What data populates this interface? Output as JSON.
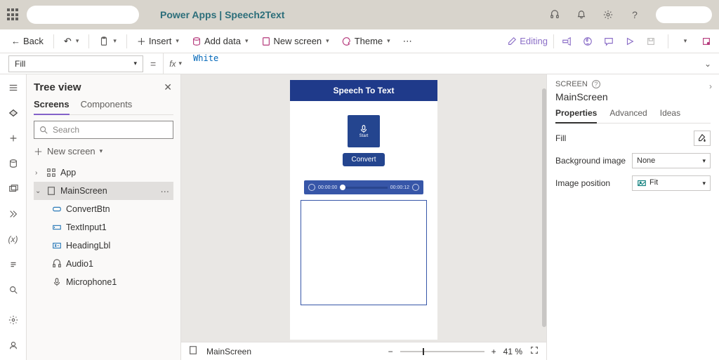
{
  "header": {
    "app": "Power Apps",
    "pipe": "|",
    "doc": "Speech2Text"
  },
  "commandbar": {
    "back": "Back",
    "insert": "Insert",
    "add_data": "Add data",
    "new_screen": "New screen",
    "theme": "Theme",
    "editing": "Editing"
  },
  "formula": {
    "property": "Fill",
    "value": "White"
  },
  "tree": {
    "title": "Tree view",
    "tabs": {
      "screens": "Screens",
      "components": "Components"
    },
    "search_placeholder": "Search",
    "new_screen": "New screen",
    "items": {
      "app": "App",
      "main": "MainScreen",
      "children": [
        "ConvertBtn",
        "TextInput1",
        "HeadingLbl",
        "Audio1",
        "Microphone1"
      ]
    }
  },
  "canvas": {
    "heading": "Speech To Text",
    "mic_label": "Start",
    "button": "Convert",
    "audio": {
      "current": "00:00:00",
      "total": "00:00:12"
    },
    "status_name": "MainScreen",
    "zoom": "41 %"
  },
  "props": {
    "screen_label": "SCREEN",
    "screen_name": "MainScreen",
    "tabs": {
      "properties": "Properties",
      "advanced": "Advanced",
      "ideas": "Ideas"
    },
    "fill": "Fill",
    "bgimg_label": "Background image",
    "bgimg_value": "None",
    "imgpos_label": "Image position",
    "imgpos_value": "Fit"
  }
}
